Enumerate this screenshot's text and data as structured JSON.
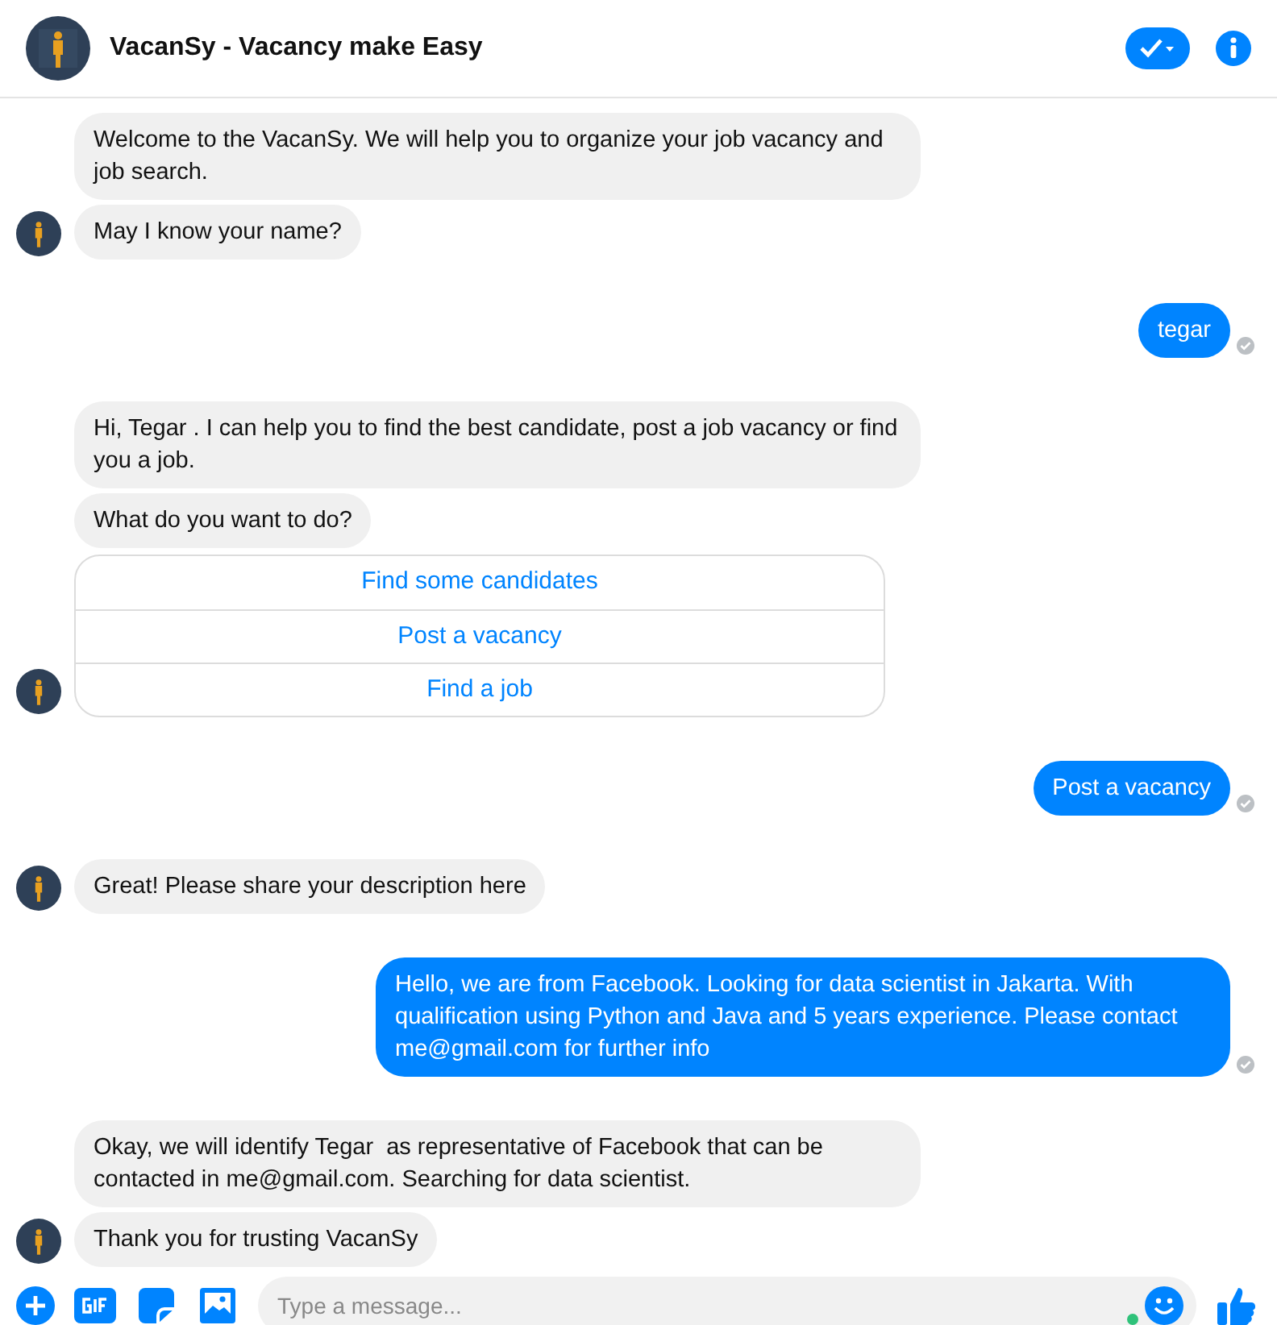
{
  "header": {
    "title": "VacanSy - Vacancy make Easy"
  },
  "messages": [
    {
      "kind": "bot",
      "items": [
        {
          "kind": "text",
          "text": "Welcome to the VacanSy. We will help you to organize your job vacancy and job search."
        },
        {
          "kind": "text",
          "text": "May I know your name?"
        }
      ]
    },
    {
      "kind": "user",
      "items": [
        {
          "kind": "text",
          "text": "tegar"
        }
      ]
    },
    {
      "kind": "bot",
      "items": [
        {
          "kind": "text",
          "text": "Hi, Tegar . I can help you to find the best candidate, post a job vacancy or find you a job."
        },
        {
          "kind": "text",
          "text": "What do you want to do?"
        },
        {
          "kind": "quick_replies",
          "options": [
            "Find some candidates",
            "Post a vacancy",
            "Find a job"
          ]
        }
      ]
    },
    {
      "kind": "user",
      "items": [
        {
          "kind": "text",
          "text": "Post a vacancy"
        }
      ]
    },
    {
      "kind": "bot",
      "items": [
        {
          "kind": "text",
          "text": "Great! Please share your description here"
        }
      ]
    },
    {
      "kind": "user",
      "items": [
        {
          "kind": "text",
          "text": "Hello, we are from Facebook. Looking for data scientist in Jakarta. With qualification using Python and Java and 5 years experience. Please contact me@gmail.com for further info"
        }
      ]
    },
    {
      "kind": "bot",
      "items": [
        {
          "kind": "text",
          "text": "Okay, we will identify Tegar  as representative of Facebook that can be contacted in me@gmail.com. Searching for data scientist."
        },
        {
          "kind": "text",
          "text": "Thank you for trusting VacanSy"
        }
      ]
    }
  ],
  "composer": {
    "placeholder": "Type a message..."
  }
}
